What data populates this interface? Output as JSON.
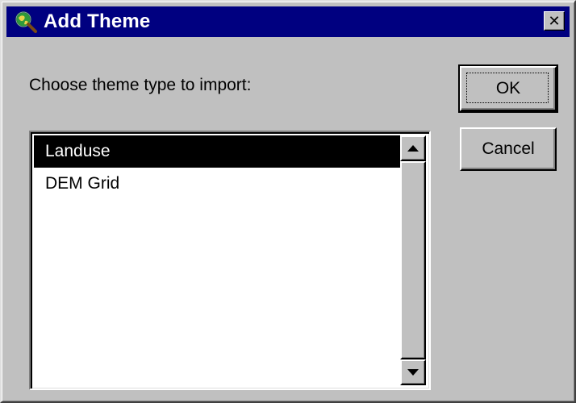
{
  "window": {
    "title": "Add Theme",
    "title_icon": "globe-magnifier-icon",
    "close_glyph": "✕",
    "colors": {
      "titlebar": "#000080",
      "dialog_bg": "#c0c0c0",
      "selection": "#000000"
    }
  },
  "prompt": {
    "label": "Choose theme type to import:"
  },
  "buttons": {
    "ok_label": "OK",
    "cancel_label": "Cancel"
  },
  "theme_list": {
    "items": [
      {
        "label": "Landuse",
        "selected": true
      },
      {
        "label": "DEM Grid",
        "selected": false
      }
    ]
  }
}
